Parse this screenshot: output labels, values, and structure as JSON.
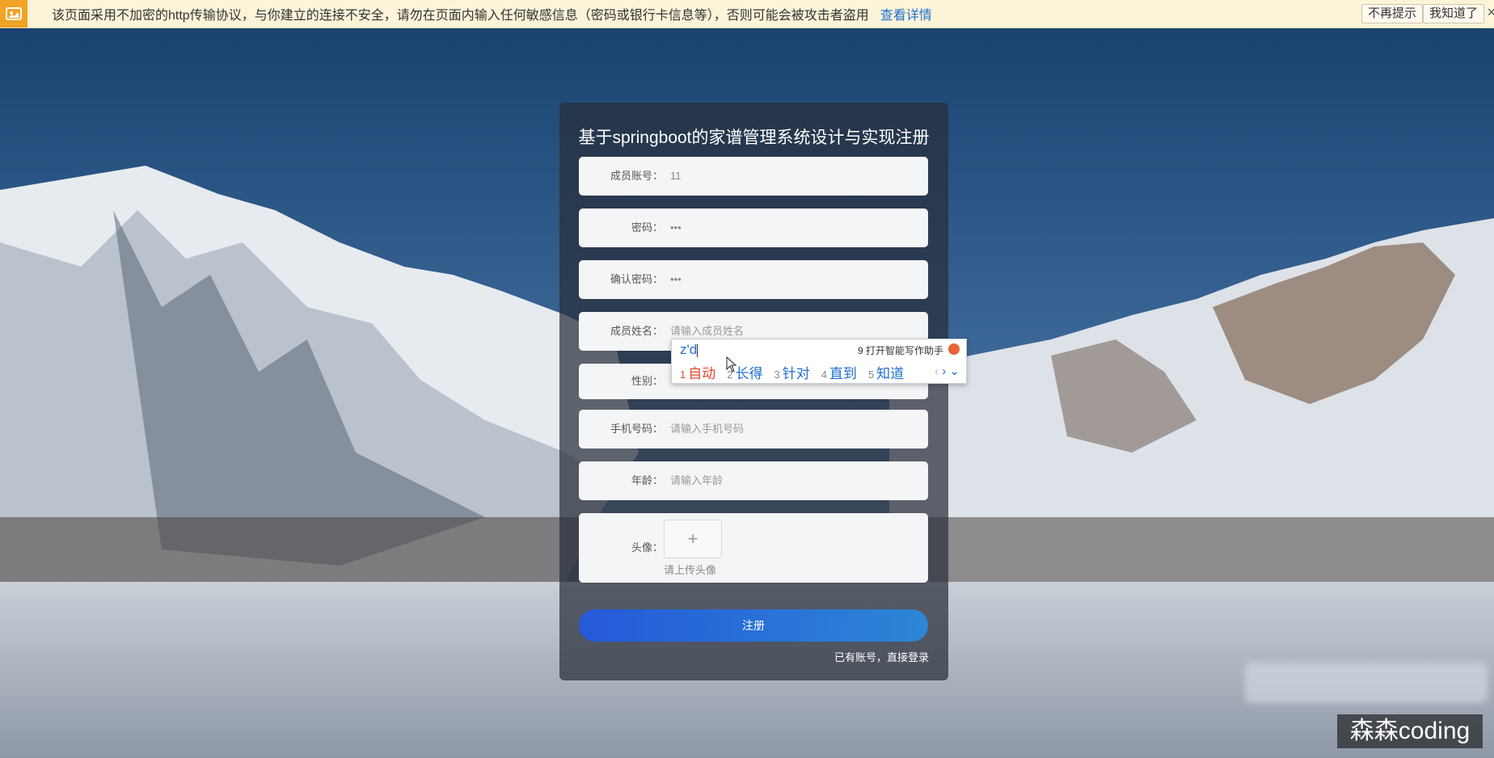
{
  "warning_bar": {
    "message": "该页面采用不加密的http传输协议，与你建立的连接不安全，请勿在页面内输入任何敏感信息（密码或银行卡信息等），否则可能会被攻击者盗用",
    "details_link": "查看详情",
    "dont_remind": "不再提示",
    "got_it": "我知道了",
    "close": "×"
  },
  "form": {
    "title": "基于springboot的家谱管理系统设计与实现注册",
    "account": {
      "label": "成员账号：",
      "value": "11"
    },
    "password": {
      "label": "密码：",
      "value": "•••"
    },
    "confirm_password": {
      "label": "确认密码：",
      "value": "•••"
    },
    "name": {
      "label": "成员姓名：",
      "placeholder": "请输入成员姓名"
    },
    "gender": {
      "label": "性别："
    },
    "phone": {
      "label": "手机号码：",
      "placeholder": "请输入手机号码"
    },
    "age": {
      "label": "年龄：",
      "placeholder": "请输入年龄"
    },
    "avatar": {
      "label": "头像：",
      "upload_symbol": "+",
      "hint": "请上传头像"
    },
    "submit": "注册",
    "login_link": "已有账号，直接登录"
  },
  "ime": {
    "composition": "z'd",
    "assistant": "9 打开智能写作助手",
    "candidates": [
      {
        "num": "1",
        "text": "自动"
      },
      {
        "num": "2",
        "text": "长得"
      },
      {
        "num": "3",
        "text": "针对"
      },
      {
        "num": "4",
        "text": "直到"
      },
      {
        "num": "5",
        "text": "知道"
      }
    ],
    "nav_prev": "‹",
    "nav_next": "›",
    "nav_more": "⌄"
  },
  "watermark": "森森coding",
  "colors": {
    "accent_blue": "#2559d9",
    "warning_bg": "#fbf4d8",
    "ime_first_candidate": "#e04a2b"
  }
}
